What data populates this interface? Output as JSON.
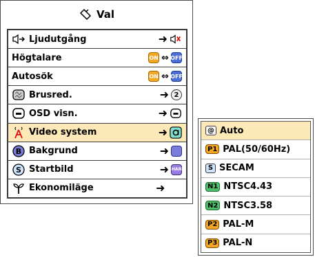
{
  "menu": {
    "title": "Val",
    "title_icon": "sparkle-icon",
    "items": [
      {
        "label": "Ljudutgång",
        "icon": "speaker-arrow-icon",
        "control": "speaker-red-icon"
      },
      {
        "label": "Högtalare",
        "control_left": "ON",
        "control_right": "OFF"
      },
      {
        "label": "Autosök",
        "control_left": "ON",
        "control_right": "OFF"
      },
      {
        "label": "Brusred.",
        "icon": "noise-icon",
        "control": "2"
      },
      {
        "label": "OSD visn.",
        "icon": "osd-icon",
        "control": "osd-icon"
      },
      {
        "label": "Video system",
        "icon": "antenna-icon",
        "control": "auto-icon",
        "selected": true
      },
      {
        "label": "Bakgrund",
        "icon": "b-icon",
        "control": "background-icon"
      },
      {
        "label": "Startbild",
        "icon": "s-icon",
        "control": "SHARP"
      },
      {
        "label": "Ekonomiläge",
        "icon": "sprout-icon"
      }
    ]
  },
  "submenu": {
    "options": [
      {
        "badge": "@",
        "label": "Auto",
        "selected": true
      },
      {
        "badge": "P1",
        "label": "PAL(50/60Hz)"
      },
      {
        "badge": "S",
        "label": "SECAM"
      },
      {
        "badge": "N1",
        "label": "NTSC4.43"
      },
      {
        "badge": "N2",
        "label": "NTSC3.58"
      },
      {
        "badge": "P2",
        "label": "PAL-M"
      },
      {
        "badge": "P3",
        "label": "PAL-N"
      }
    ]
  },
  "colors": {
    "highlight": "#fde8b8",
    "on": "#f5a623",
    "off": "#4b6fd6"
  }
}
